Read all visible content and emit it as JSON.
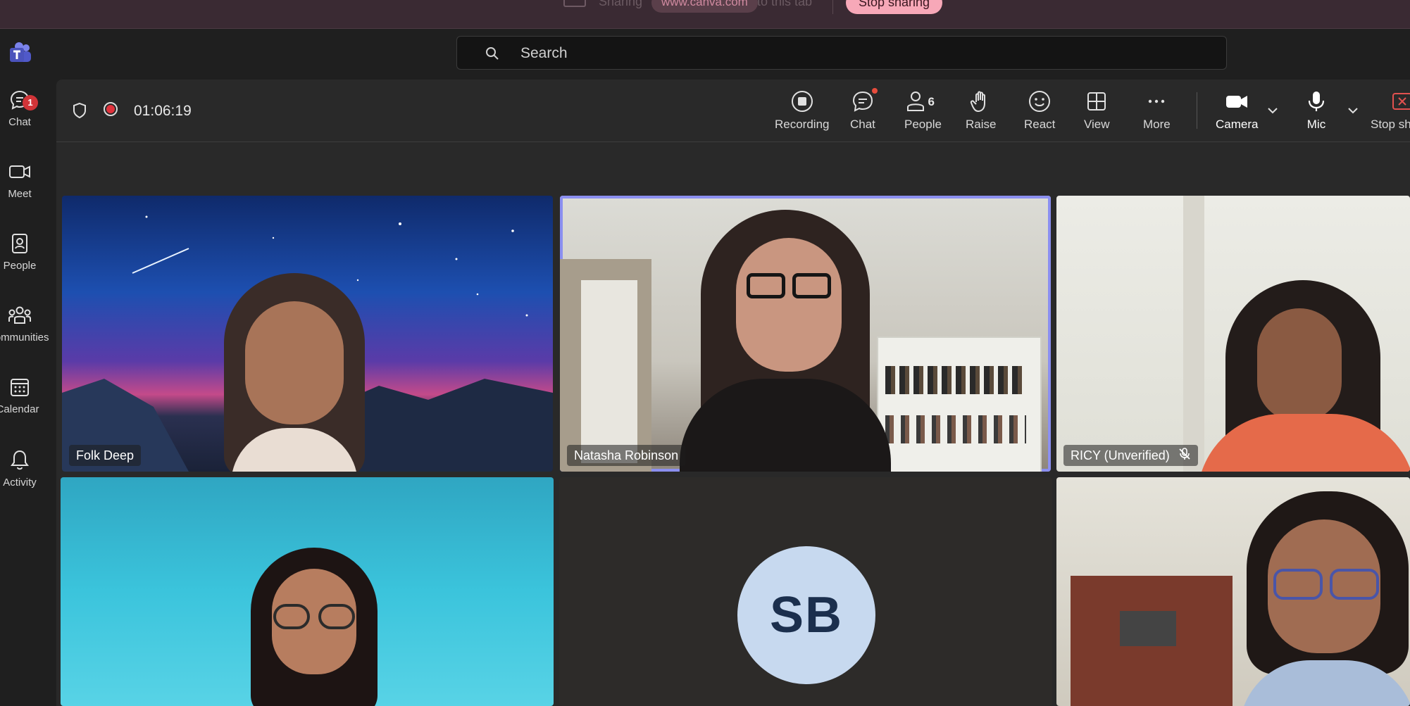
{
  "share_bar": {
    "text_before": "Sharing",
    "url": "www.canva.com",
    "text_after": "to this tab",
    "stop_label": "Stop sharing"
  },
  "app_bar": {
    "search_placeholder": "Search"
  },
  "rail": {
    "items": [
      {
        "label": "Chat",
        "icon": "chat-icon",
        "badge": "1"
      },
      {
        "label": "Meet",
        "icon": "video-camera-icon"
      },
      {
        "label": "People",
        "icon": "contact-book-icon"
      },
      {
        "label": "Communities",
        "icon": "communities-icon"
      },
      {
        "label": "Calendar",
        "icon": "calendar-icon"
      },
      {
        "label": "Activity",
        "icon": "bell-icon"
      }
    ]
  },
  "meeting": {
    "timer": "01:06:19",
    "toolbar": {
      "recording": "Recording",
      "chat": "Chat",
      "people": "People",
      "people_count": "6",
      "raise": "Raise",
      "react": "React",
      "view": "View",
      "more": "More",
      "camera": "Camera",
      "mic": "Mic",
      "stop_share": "Stop sharing"
    },
    "participants": [
      {
        "name": "Folk Deep"
      },
      {
        "name": "Natasha Robinson",
        "active_speaker": true
      },
      {
        "name": "RICY (Unverified)",
        "muted": true
      },
      {
        "name": ""
      },
      {
        "name": "",
        "initials": "SB"
      },
      {
        "name": ""
      }
    ]
  },
  "colors": {
    "accent": "#8b8ff0",
    "badge": "#d13438",
    "stop_sharing": "#f7a8b8",
    "avatar_bg": "#c7d9ef"
  }
}
